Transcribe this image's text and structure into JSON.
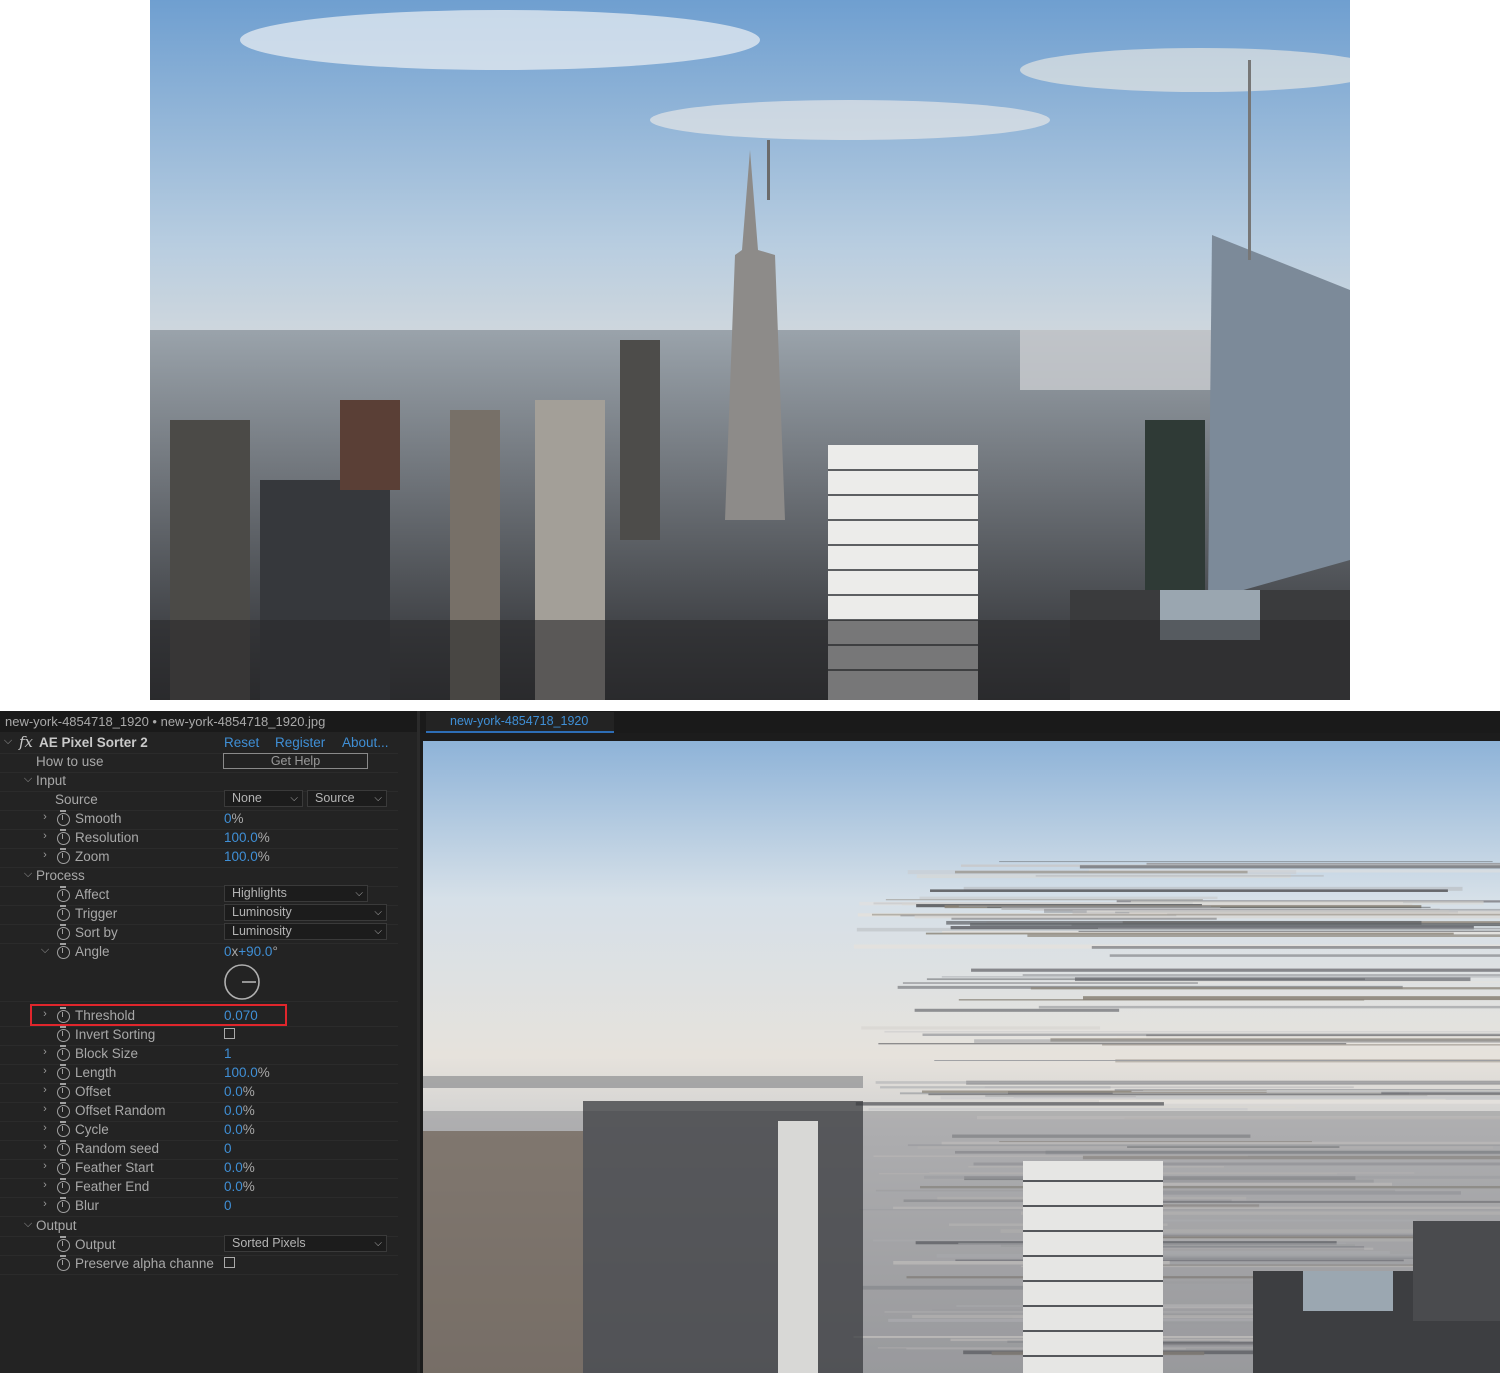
{
  "effect_controls": {
    "header": "new-york-4854718_1920 • new-york-4854718_1920.jpg",
    "effect_name": "AE Pixel Sorter 2",
    "links": {
      "reset": "Reset",
      "register": "Register",
      "about": "About..."
    },
    "how_to_use": {
      "label": "How to use",
      "button": "Get Help"
    },
    "input": {
      "label": "Input",
      "source": {
        "label": "Source",
        "value1": "None",
        "value2": "Source"
      },
      "smooth": {
        "label": "Smooth",
        "value": "0",
        "unit": "%"
      },
      "resolution": {
        "label": "Resolution",
        "value": "100.0",
        "unit": "%"
      },
      "zoom": {
        "label": "Zoom",
        "value": "100.0",
        "unit": "%"
      }
    },
    "process": {
      "label": "Process",
      "affect": {
        "label": "Affect",
        "value": "Highlights"
      },
      "trigger": {
        "label": "Trigger",
        "value": "Luminosity"
      },
      "sort_by": {
        "label": "Sort by",
        "value": "Luminosity"
      },
      "angle": {
        "label": "Angle",
        "revolutions": "0",
        "x": "x",
        "degrees": "+90.0",
        "unit": "°"
      },
      "threshold": {
        "label": "Threshold",
        "value": "0.070"
      },
      "invert_sorting": {
        "label": "Invert Sorting",
        "checked": false
      },
      "block_size": {
        "label": "Block Size",
        "value": "1"
      },
      "length": {
        "label": "Length",
        "value": "100.0",
        "unit": "%"
      },
      "offset": {
        "label": "Offset",
        "value": "0.0",
        "unit": "%"
      },
      "offset_random": {
        "label": "Offset Random",
        "value": "0.0",
        "unit": "%"
      },
      "cycle": {
        "label": "Cycle",
        "value": "0.0",
        "unit": "%"
      },
      "random_seed": {
        "label": "Random seed",
        "value": "0"
      },
      "feather_start": {
        "label": "Feather Start",
        "value": "0.0",
        "unit": "%"
      },
      "feather_end": {
        "label": "Feather End",
        "value": "0.0",
        "unit": "%"
      },
      "blur": {
        "label": "Blur",
        "value": "0"
      }
    },
    "output": {
      "label": "Output",
      "output": {
        "label": "Output",
        "value": "Sorted Pixels"
      },
      "preserve_alpha": {
        "label": "Preserve alpha channe",
        "checked": false
      }
    }
  },
  "viewer": {
    "tab_label": "new-york-4854718_1920"
  },
  "colors": {
    "accent_blue": "#3f8fd6",
    "highlight_red": "#e0262c",
    "panel_bg": "#232323"
  }
}
